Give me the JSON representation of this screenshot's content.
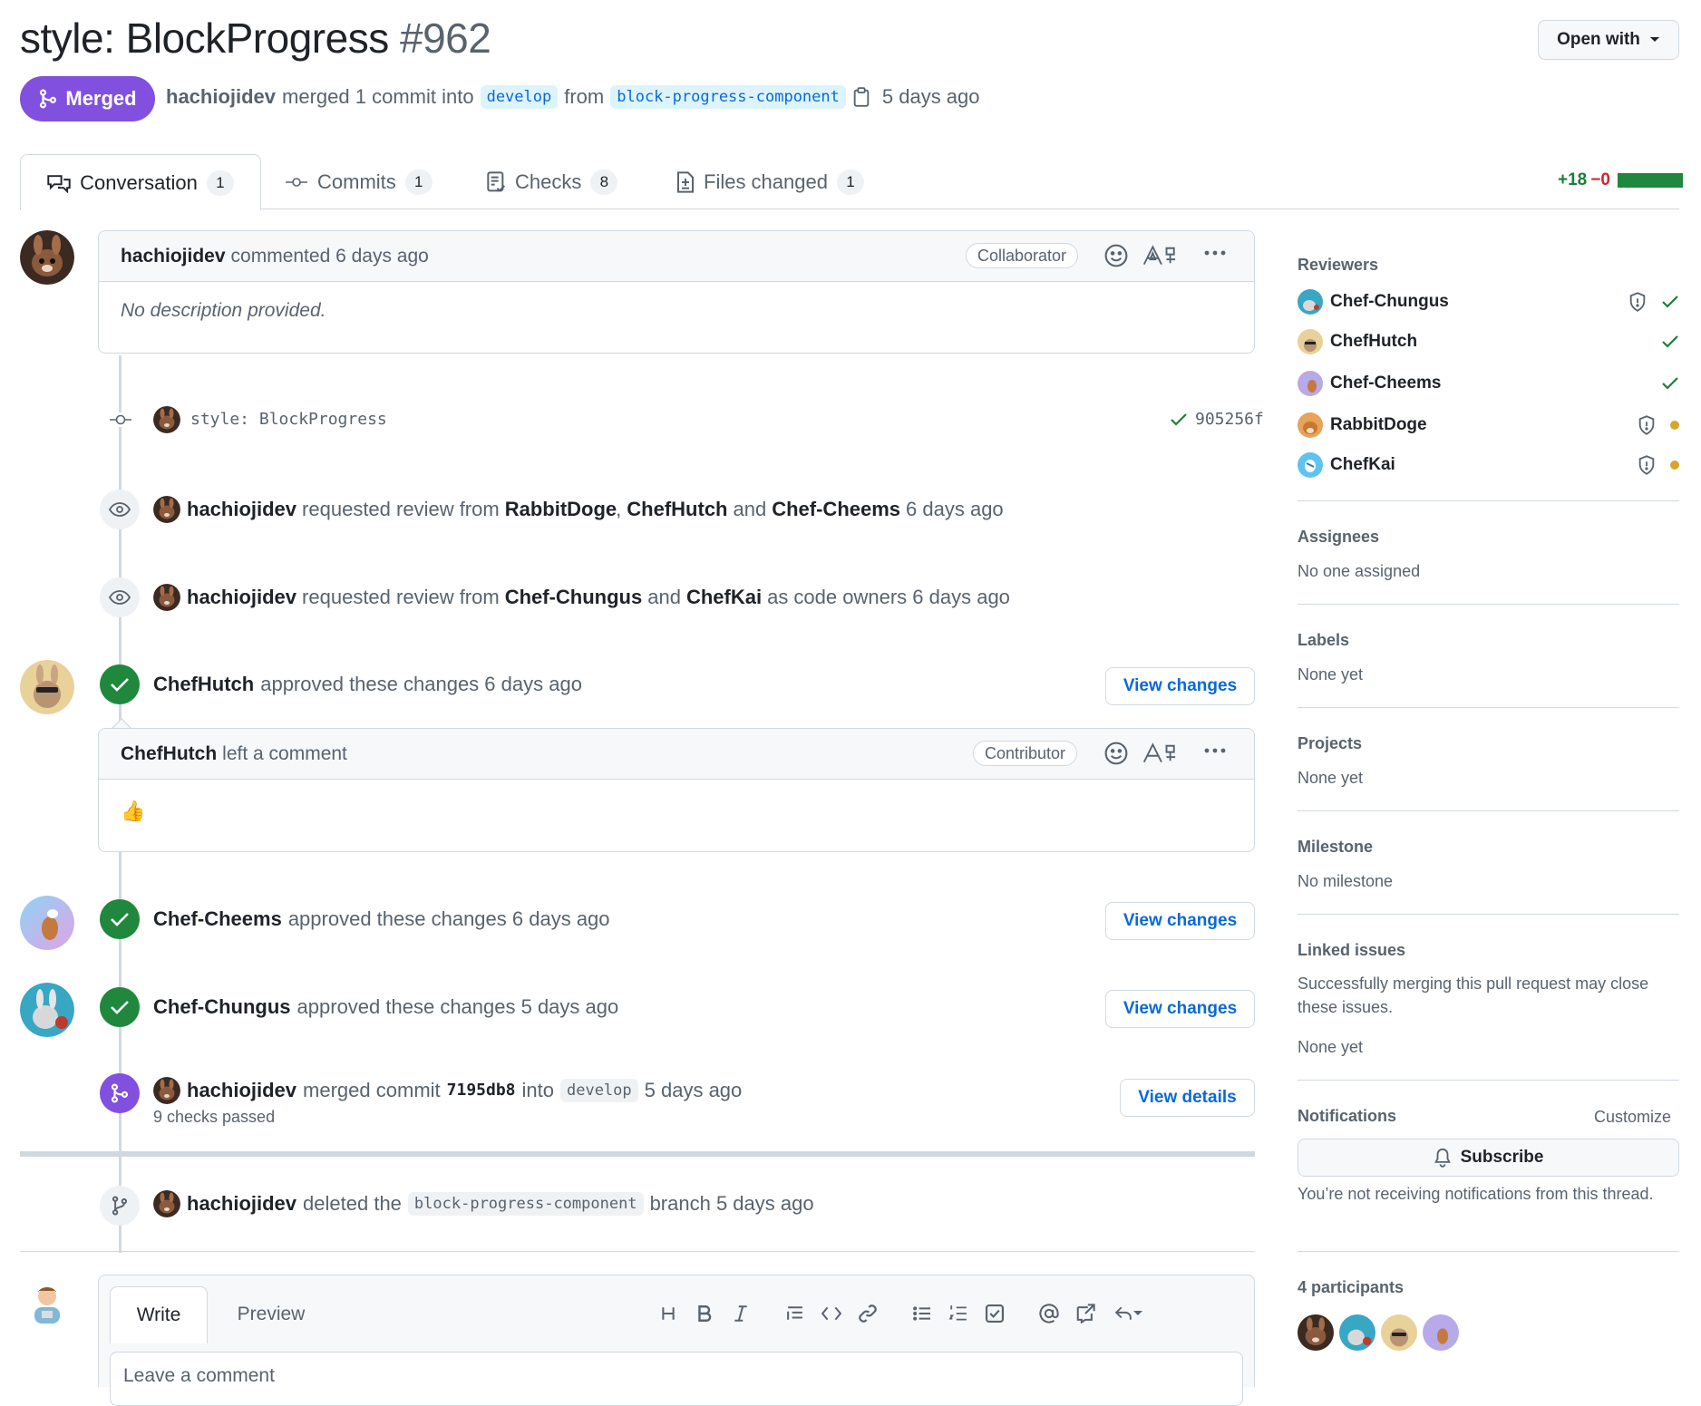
{
  "header": {
    "title": "style: BlockProgress",
    "number": "#962",
    "open_with": "Open with",
    "state": "Merged",
    "author": "hachiojidev",
    "merge_text": "merged 1 commit into",
    "base_branch": "develop",
    "from_text": "from",
    "head_branch": "block-progress-component",
    "time": "5 days ago"
  },
  "tabs": [
    {
      "label": "Conversation",
      "count": "1"
    },
    {
      "label": "Commits",
      "count": "1"
    },
    {
      "label": "Checks",
      "count": "8"
    },
    {
      "label": "Files changed",
      "count": "1"
    }
  ],
  "diffstat": {
    "additions": "+18",
    "deletions": "−0"
  },
  "timeline": {
    "first_comment": {
      "author": "hachiojidev",
      "action": "commented 6 days ago",
      "role": "Collaborator",
      "body": "No description provided."
    },
    "commit": {
      "message": "style: BlockProgress",
      "sha": "905256f"
    },
    "review_request_1": {
      "author": "hachiojidev",
      "text1": "requested review from",
      "user1": "RabbitDoge",
      "sep": ",",
      "user2": "ChefHutch",
      "and": "and",
      "user3": "Chef-Cheems",
      "time": "6 days ago"
    },
    "review_request_2": {
      "author": "hachiojidev",
      "text1": "requested review from",
      "user1": "Chef-Chungus",
      "and": "and",
      "user2": "ChefKai",
      "suffix": "as code owners 6 days ago"
    },
    "approval_1": {
      "author": "ChefHutch",
      "text": "approved these changes 6 days ago",
      "button": "View changes"
    },
    "review_comment": {
      "author": "ChefHutch",
      "action": "left a comment",
      "role": "Contributor",
      "body": "👍"
    },
    "approval_2": {
      "author": "Chef-Cheems",
      "text": "approved these changes 6 days ago",
      "button": "View changes"
    },
    "approval_3": {
      "author": "Chef-Chungus",
      "text": "approved these changes 5 days ago",
      "button": "View changes"
    },
    "merge_event": {
      "author": "hachiojidev",
      "text1": "merged commit",
      "sha": "7195db8",
      "text2": "into",
      "branch": "develop",
      "time": "5 days ago",
      "checks": "9 checks passed",
      "button": "View details"
    },
    "delete_event": {
      "author": "hachiojidev",
      "text1": "deleted the",
      "branch": "block-progress-component",
      "text2": "branch 5 days ago"
    }
  },
  "editor": {
    "write_tab": "Write",
    "preview_tab": "Preview",
    "placeholder": "Leave a comment"
  },
  "sidebar": {
    "reviewers_title": "Reviewers",
    "reviewers": [
      {
        "name": "Chef-Chungus",
        "status": "approved",
        "codeowner": true
      },
      {
        "name": "ChefHutch",
        "status": "approved",
        "codeowner": false
      },
      {
        "name": "Chef-Cheems",
        "status": "approved",
        "codeowner": false
      },
      {
        "name": "RabbitDoge",
        "status": "pending",
        "codeowner": true
      },
      {
        "name": "ChefKai",
        "status": "pending",
        "codeowner": true
      }
    ],
    "assignees_title": "Assignees",
    "assignees_value": "No one assigned",
    "labels_title": "Labels",
    "labels_value": "None yet",
    "projects_title": "Projects",
    "projects_value": "None yet",
    "milestone_title": "Milestone",
    "milestone_value": "No milestone",
    "linked_title": "Linked issues",
    "linked_desc": "Successfully merging this pull request may close these issues.",
    "linked_value": "None yet",
    "notifications_title": "Notifications",
    "customize": "Customize",
    "subscribe": "Subscribe",
    "notif_desc": "You’re not receiving notifications from this thread.",
    "participants_title": "4 participants"
  },
  "colors": {
    "merged": "#8250df",
    "approved": "#1f883d",
    "link": "#0969da",
    "pending": "#d4a72c"
  }
}
